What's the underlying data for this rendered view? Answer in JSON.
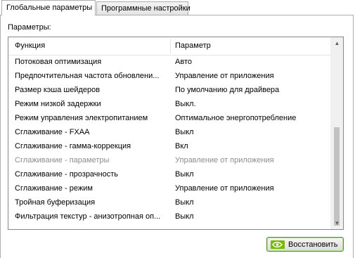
{
  "tabs": [
    {
      "label": "Глобальные параметры",
      "active": true
    },
    {
      "label": "Программные настройки",
      "active": false
    }
  ],
  "group_label": "Параметры:",
  "table": {
    "columns": [
      "Функция",
      "Параметр"
    ],
    "rows": [
      {
        "feature": "Потоковая оптимизация",
        "value": "Авто"
      },
      {
        "feature": "Предпочтительная частота обновлени...",
        "value": "Управление от приложения"
      },
      {
        "feature": "Размер кэша шейдеров",
        "value": "По умолчанию для драйвера"
      },
      {
        "feature": "Режим низкой задержки",
        "value": "Выкл."
      },
      {
        "feature": "Режим управления электропитанием",
        "value": "Оптимальное энергопотребление"
      },
      {
        "feature": "Сглаживание - FXAA",
        "value": "Выкл"
      },
      {
        "feature": "Сглаживание - гамма-коррекция",
        "value": "Вкл"
      },
      {
        "feature": "Сглаживание - параметры",
        "value": "Управление от приложения",
        "disabled": true
      },
      {
        "feature": "Сглаживание - прозрачность",
        "value": "Выкл"
      },
      {
        "feature": "Сглаживание - режим",
        "value": "Управление от приложения"
      },
      {
        "feature": "Тройная буферизация",
        "value": "Выкл"
      },
      {
        "feature": "Фильтрация текстур - анизотропная оп...",
        "value": "Выкл"
      }
    ]
  },
  "restore_button": {
    "label": "Восстановить",
    "icon": "nvidia-logo-icon"
  },
  "colors": {
    "accent_green": "#76b900",
    "border": "#828790"
  }
}
